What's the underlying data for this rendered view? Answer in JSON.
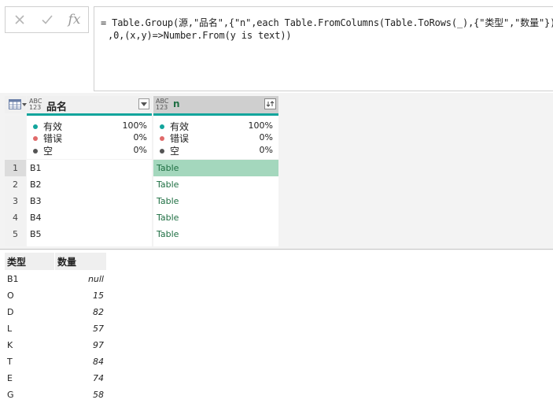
{
  "formula_bar": {
    "cancel_icon": "x-icon",
    "commit_icon": "check-icon",
    "fx_label": "fx",
    "line1": "= Table.Group(源,\"品名\",{\"n\",each Table.FromColumns(Table.ToRows(_),{\"类型\",\"数量\"}) }",
    "line2": ",0,(x,y)=>Number.From(y is text))"
  },
  "grid": {
    "corner_icon": "table-icon",
    "columns": [
      {
        "type_label_top": "ABC",
        "type_label_bottom": "123",
        "name": "品名",
        "menu_icon": "dropdown-icon"
      },
      {
        "type_label_top": "ABC",
        "type_label_bottom": "123",
        "name": "n",
        "menu_icon": "expand-icon"
      }
    ],
    "quality": [
      {
        "valid_label": "有效",
        "valid_pct": "100%",
        "error_label": "错误",
        "error_pct": "0%",
        "empty_label": "空",
        "empty_pct": "0%"
      },
      {
        "valid_label": "有效",
        "valid_pct": "100%",
        "error_label": "错误",
        "error_pct": "0%",
        "empty_label": "空",
        "empty_pct": "0%"
      }
    ],
    "rows": [
      {
        "num": "1",
        "name": "B1",
        "n": "Table"
      },
      {
        "num": "2",
        "name": "B2",
        "n": "Table"
      },
      {
        "num": "3",
        "name": "B3",
        "n": "Table"
      },
      {
        "num": "4",
        "name": "B4",
        "n": "Table"
      },
      {
        "num": "5",
        "name": "B5",
        "n": "Table"
      }
    ],
    "colors": {
      "valid": "#12a59c",
      "error": "#e06a6a",
      "empty": "#555555",
      "selected": "#a4d7bd",
      "link": "#1f6f43"
    }
  },
  "preview": {
    "headers": [
      "类型",
      "数量"
    ],
    "rows": [
      {
        "cat": "B1",
        "val": "null"
      },
      {
        "cat": "O",
        "val": "15"
      },
      {
        "cat": "D",
        "val": "82"
      },
      {
        "cat": "L",
        "val": "57"
      },
      {
        "cat": "K",
        "val": "97"
      },
      {
        "cat": "T",
        "val": "84"
      },
      {
        "cat": "E",
        "val": "74"
      },
      {
        "cat": "G",
        "val": "58"
      }
    ]
  }
}
